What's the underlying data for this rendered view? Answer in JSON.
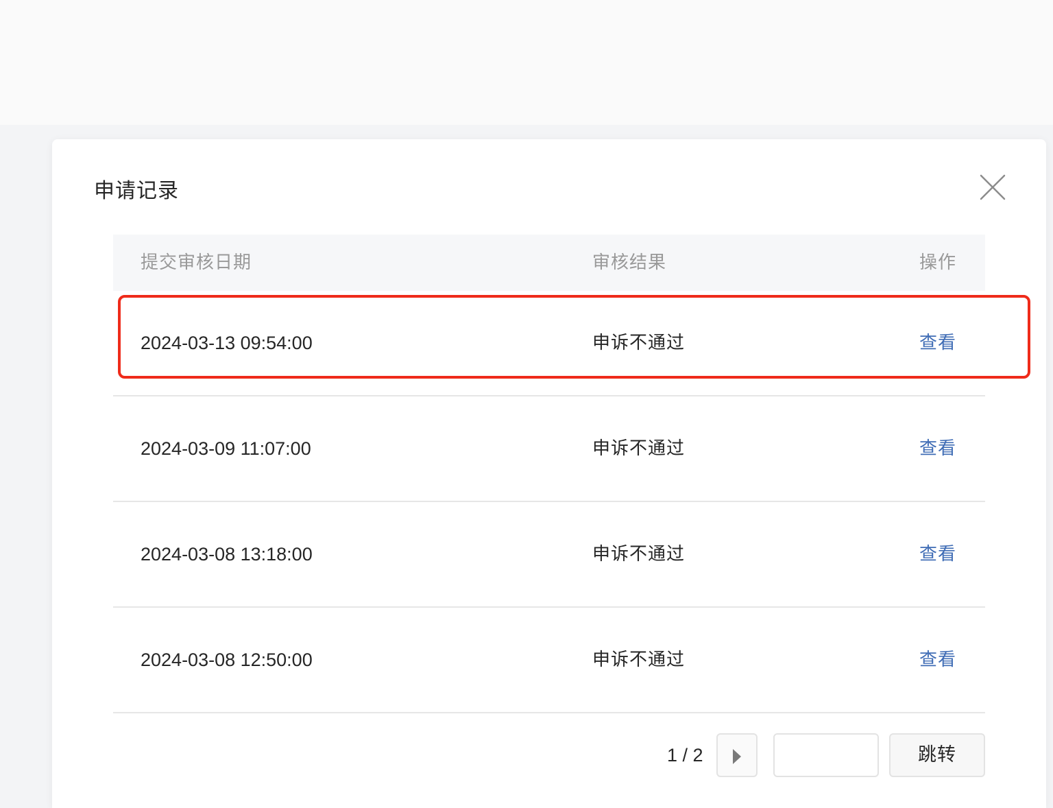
{
  "dialog": {
    "title": "申请记录",
    "close_icon": "close-icon"
  },
  "table": {
    "headers": {
      "date": "提交审核日期",
      "result": "审核结果",
      "action": "操作"
    },
    "rows": [
      {
        "date": "2024-03-13 09:54:00",
        "result": "申诉不通过",
        "action": "查看"
      },
      {
        "date": "2024-03-09 11:07:00",
        "result": "申诉不通过",
        "action": "查看"
      },
      {
        "date": "2024-03-08 13:18:00",
        "result": "申诉不通过",
        "action": "查看"
      },
      {
        "date": "2024-03-08 12:50:00",
        "result": "申诉不通过",
        "action": "查看"
      }
    ]
  },
  "pagination": {
    "page_info": "1 / 2",
    "next_icon": "caret-right-icon",
    "page_input_value": "",
    "jump_label": "跳转"
  },
  "colors": {
    "link": "#3f6cb5",
    "highlight": "#ef2b1a",
    "header_bg": "#f6f7f9"
  }
}
